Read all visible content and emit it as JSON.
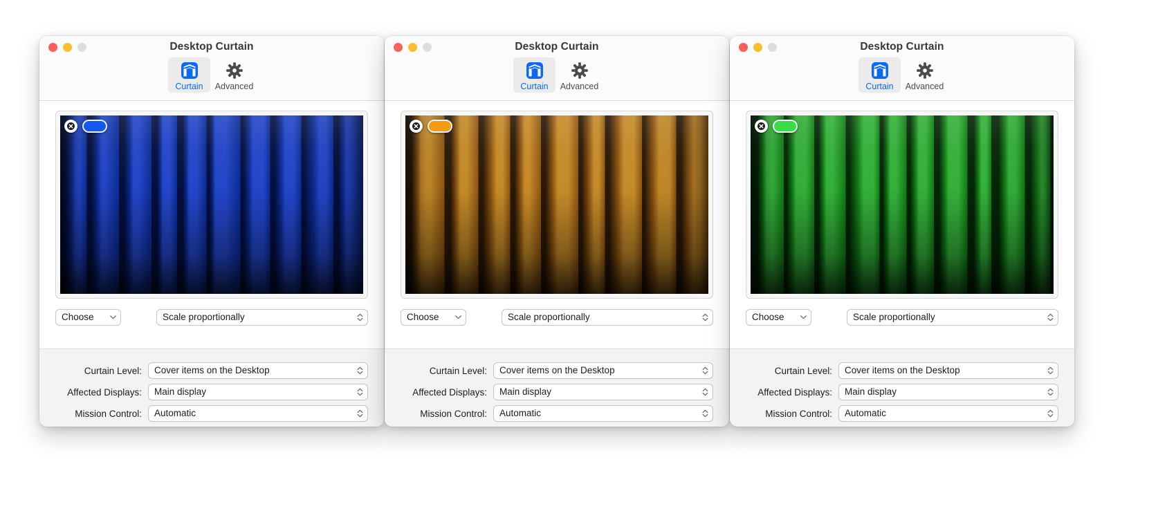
{
  "app": {
    "title": "Desktop Curtain"
  },
  "toolbar": {
    "items": [
      {
        "label": "Curtain",
        "icon": "curtain-icon",
        "active": true
      },
      {
        "label": "Advanced",
        "icon": "gear-icon",
        "active": false
      }
    ]
  },
  "traffic_lights": {
    "close": "close-window-button",
    "minimize": "minimize-window-button",
    "zoom": "zoom-window-button",
    "colors": {
      "close": "#fc5f57",
      "minimize": "#fcbd2e",
      "zoom": "#dddddd"
    }
  },
  "controls": {
    "choose_label": "Choose",
    "scale_value": "Scale proportionally",
    "curtain_level_label": "Curtain Level:",
    "curtain_level_value": "Cover items on the Desktop",
    "affected_displays_label": "Affected Displays:",
    "affected_displays_value": "Main display",
    "mission_control_label": "Mission Control:",
    "mission_control_value": "Automatic"
  },
  "windows": [
    {
      "id": "window-blue",
      "curtain_color_name": "blue",
      "pill_color": "#1558f0",
      "curtain_base": "#0b2a92",
      "curtain_dark": "#030f3e",
      "curtain_light": "#2346c8"
    },
    {
      "id": "window-orange",
      "curtain_color_name": "orange",
      "pill_color": "#f59b11",
      "curtain_base": "#8a5410",
      "curtain_dark": "#2b1805",
      "curtain_light": "#c58a28"
    },
    {
      "id": "window-green",
      "curtain_color_name": "green",
      "pill_color": "#3ddb48",
      "curtain_base": "#0f7a14",
      "curtain_dark": "#032605",
      "curtain_light": "#34b03a"
    }
  ],
  "icons": {
    "close_overlay": "close-x-icon",
    "color_pill": "curtain-color-swatch",
    "popup_chevron": "chevron-down-icon",
    "stepper": "stepper-updown-icon"
  }
}
